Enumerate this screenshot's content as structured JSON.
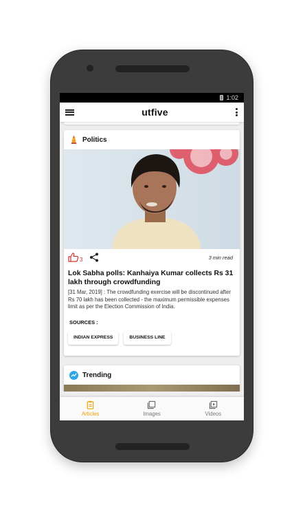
{
  "status_bar": {
    "time": "1:02"
  },
  "app_bar": {
    "title": "utfive"
  },
  "cards": [
    {
      "category": "Politics",
      "likes": "3",
      "read_time": "3 min read",
      "headline": "Lok Sabha polls: Kanhaiya Kumar collects Rs 31 lakh through crowdfunding",
      "summary": "[31 Mar, 2019] : The crowdfunding exercise will be discontinued after Rs 70 lakh has been collected - the maximum permissible expenses limit as per the Election Commission of India.",
      "sources_label": "SOURCES :",
      "sources": [
        "INDIAN EXPRESS",
        "BUSINESS LINE"
      ]
    },
    {
      "category": "Trending"
    }
  ],
  "bottom_nav": [
    {
      "label": "Articles",
      "icon": "articles-icon",
      "active": true
    },
    {
      "label": "Images",
      "icon": "images-icon",
      "active": false
    },
    {
      "label": "Videos",
      "icon": "videos-icon",
      "active": false
    }
  ],
  "colors": {
    "accent": "#f0a30a",
    "like": "#d32f2f",
    "trending": "#2fa6e8"
  }
}
